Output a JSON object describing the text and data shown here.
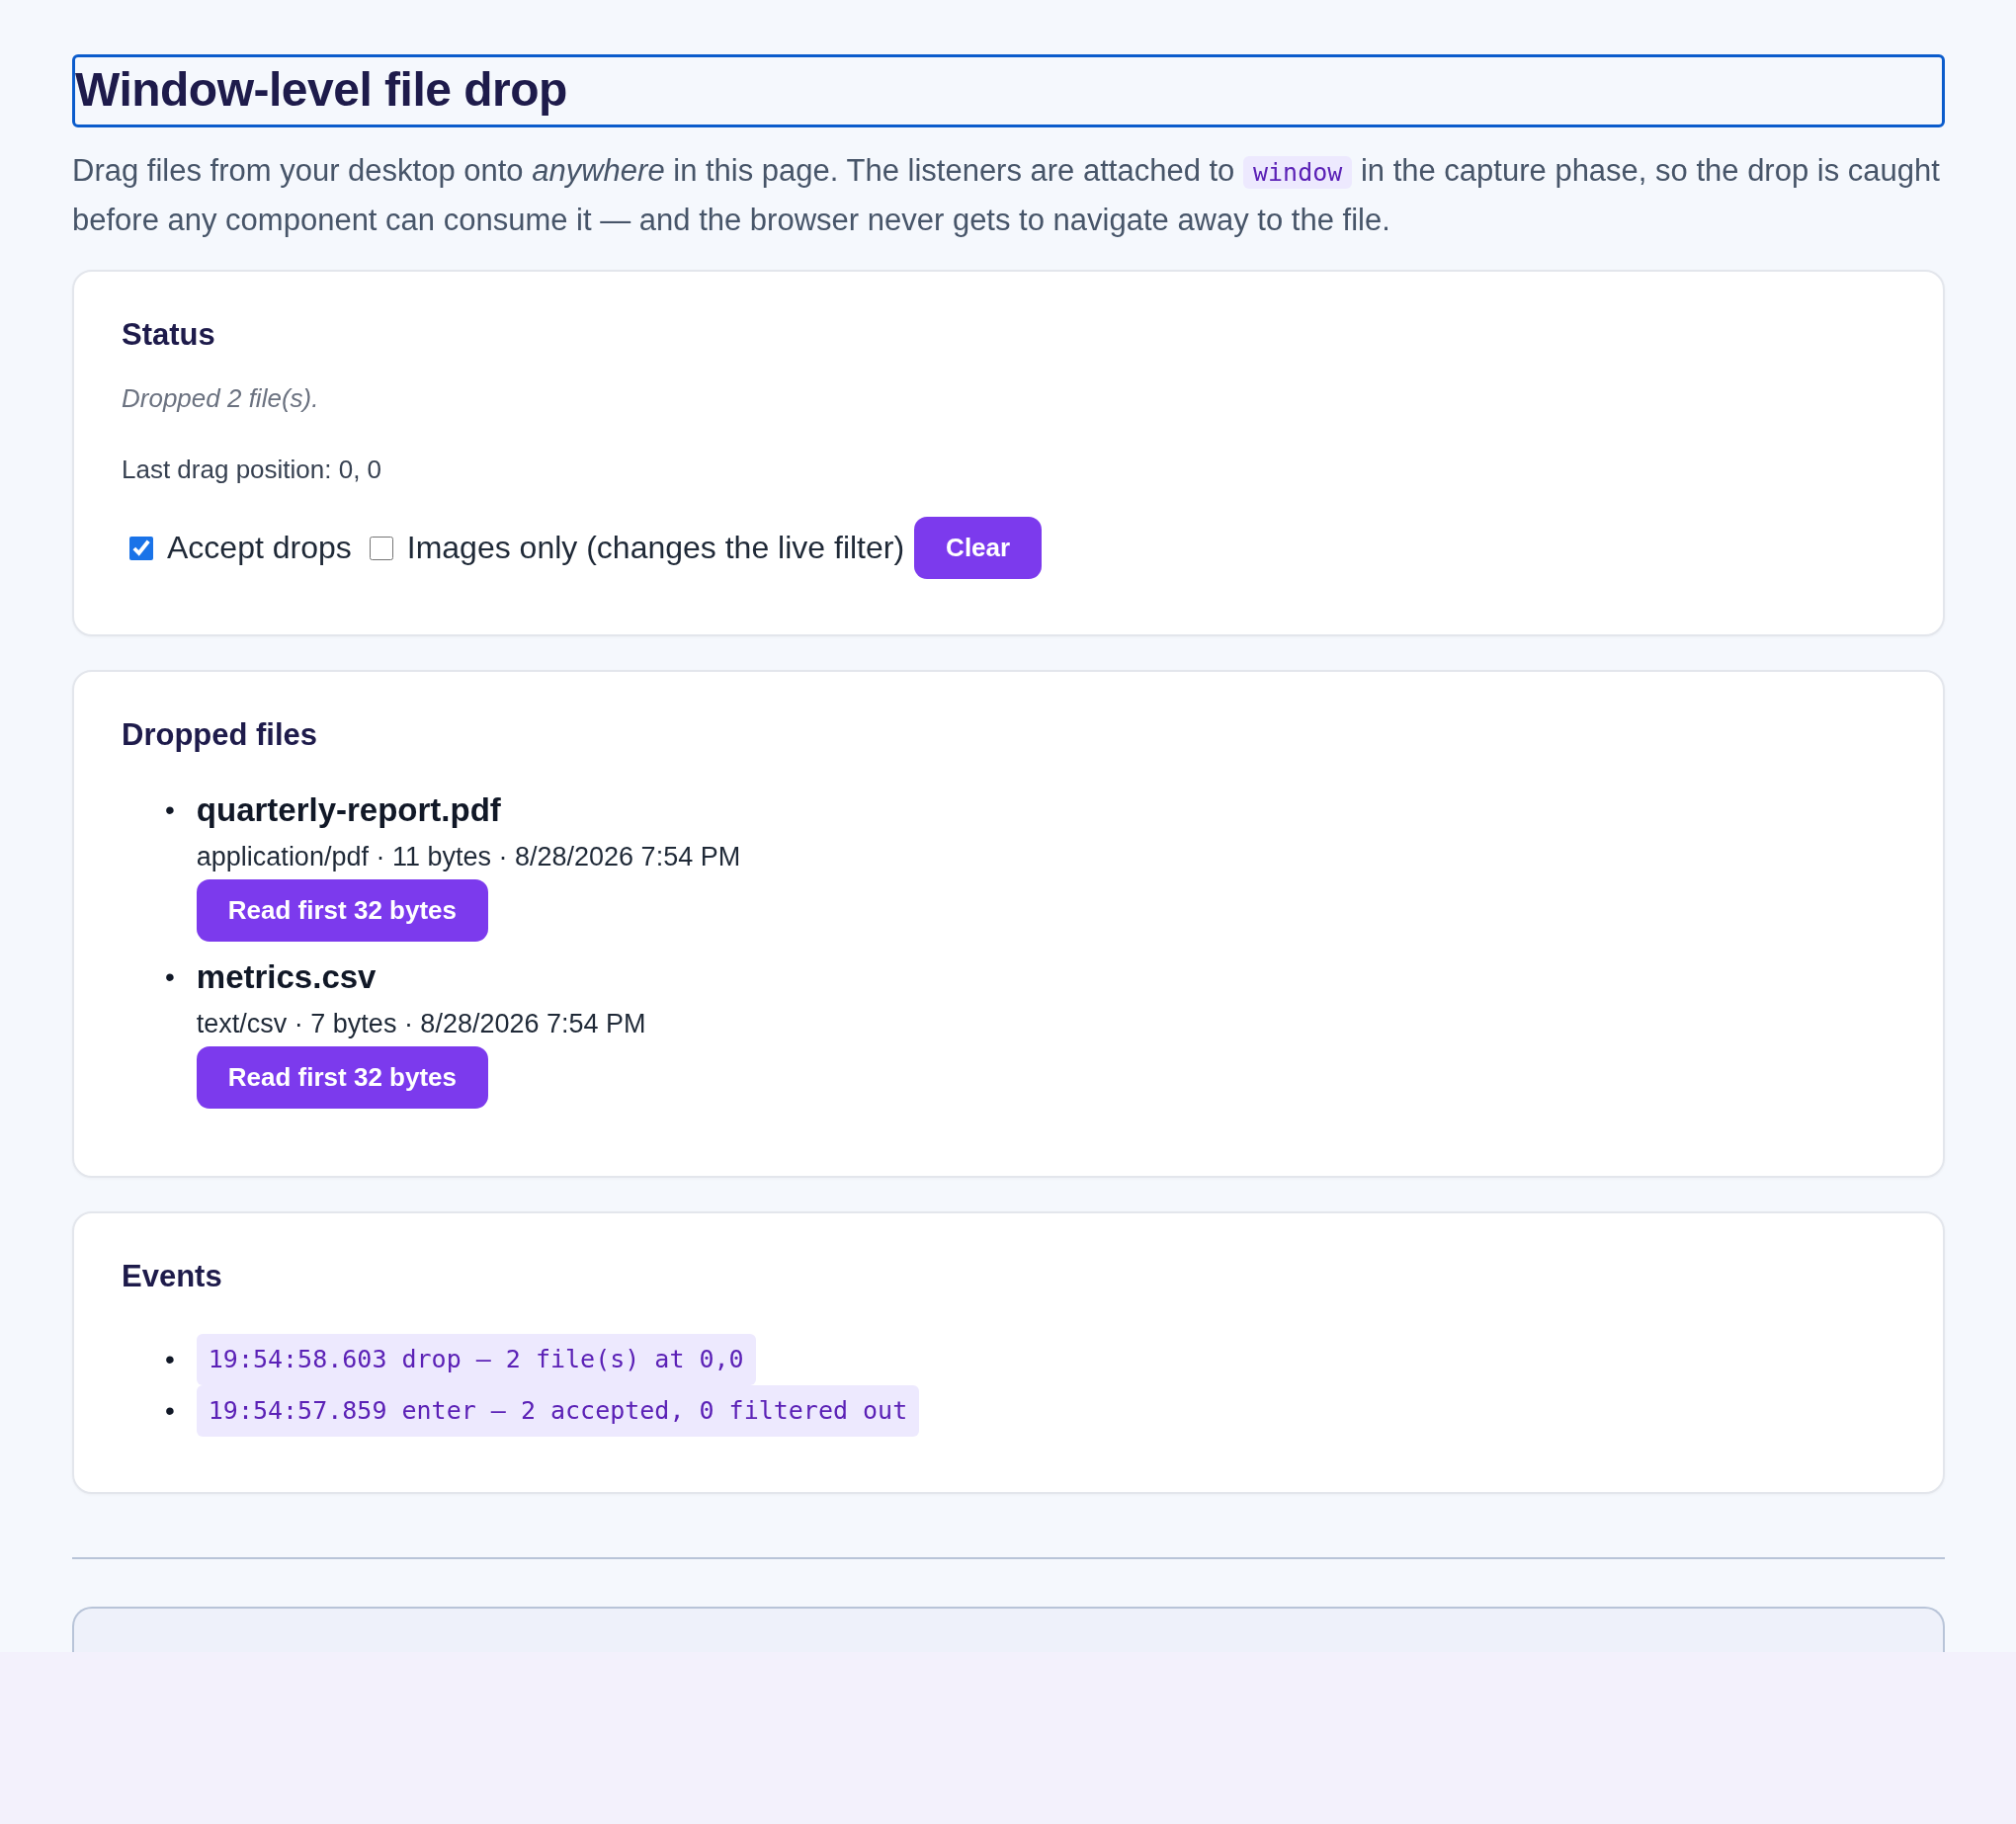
{
  "title": "Window-level file drop",
  "intro": {
    "before": "Drag files from your desktop onto *anywhere* in this page. The listeners are attached to",
    "code": "window",
    "after": "in the capture phase, so the drop is caught before any component can consume it — and the browser never gets to navigate away to the file."
  },
  "status": {
    "heading": "Status",
    "message": "Dropped 2 file(s).",
    "position": "Last drag position: 0, 0",
    "checkboxes": [
      {
        "label": "Accept drops",
        "checked": true
      },
      {
        "label": "Images only (changes the live filter)",
        "checked": false
      }
    ],
    "clear_button": "Clear"
  },
  "dropped_files": {
    "heading": "Dropped files",
    "items": [
      {
        "bullet": "•",
        "name": "quarterly-report.pdf",
        "meta": "application/pdf · 11 bytes · 8/28/2026 7:54 PM",
        "button": "Read first 32 bytes"
      },
      {
        "bullet": "•",
        "name": "metrics.csv",
        "meta": "text/csv · 7 bytes · 8/28/2026 7:54 PM",
        "button": "Read first 32 bytes"
      }
    ]
  },
  "events": {
    "heading": "Events",
    "items": [
      {
        "bullet": "•",
        "text": "19:54:58.603 drop — 2 file(s) at 0,0"
      },
      {
        "bullet": "•",
        "text": "19:54:57.859 enter — 2 accepted, 0 filtered out"
      }
    ]
  }
}
